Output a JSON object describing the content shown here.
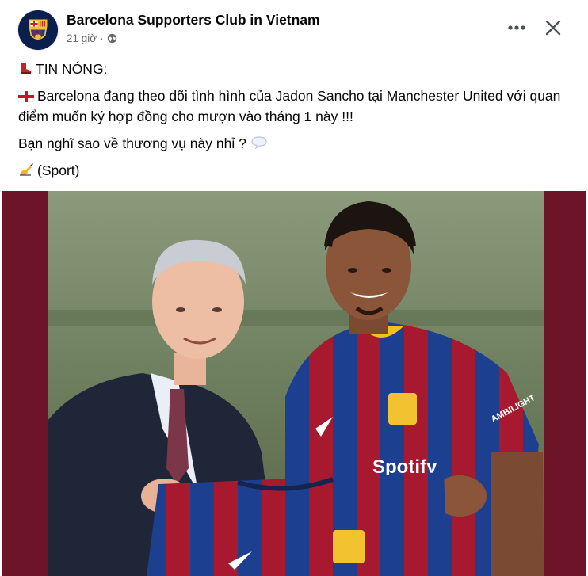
{
  "post": {
    "page_name": "Barcelona Supporters Club in Vietnam",
    "time": "21 giờ",
    "icons": {
      "avatar": "fc-barcelona-crest",
      "audience": "globe-icon",
      "more": "more-horizontal-icon",
      "close": "close-icon"
    },
    "lines": {
      "headline": "TIN NÓNG:",
      "body_1": "Barcelona đang theo dõi tình hình của Jadon Sancho tại Manchester United với quan điểm muốn ký hợp đồng cho mượn vào tháng 1 này !!!",
      "question": "Bạn nghĩ sao về thương vụ này nhỉ ?",
      "source": "(Sport)"
    },
    "emojis": {
      "headline": "red-boot-emoji",
      "body_1": "england-flag-emoji",
      "question": "speech-bubble-emoji",
      "source": "writing-hand-emoji"
    },
    "image": {
      "description_icon": "photo-two-men-holding-barcelona-shirt",
      "shirt_text": "Spotify",
      "sleeve_text": "AMBILIGHT"
    },
    "colors": {
      "frame": "#6e1428",
      "blaugrana_blue": "#1c3f8f",
      "blaugrana_red": "#a7192e",
      "text_secondary": "#65676b"
    }
  }
}
